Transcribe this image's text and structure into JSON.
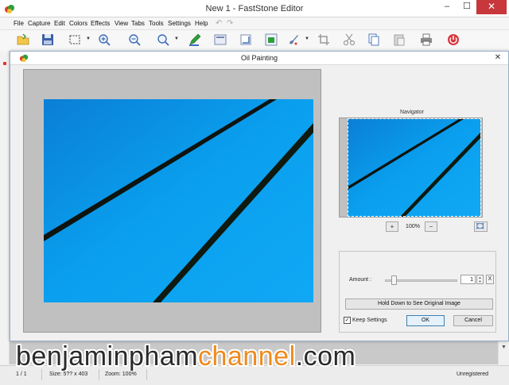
{
  "window": {
    "title": "New 1 - FastStone Editor",
    "controls": {
      "minimize": "–",
      "maximize": "☐",
      "close": "✕"
    }
  },
  "menu": [
    {
      "label": "File"
    },
    {
      "label": "Capture"
    },
    {
      "label": "Edit"
    },
    {
      "label": "Colors"
    },
    {
      "label": "Effects"
    },
    {
      "label": "View"
    },
    {
      "label": "Tabs"
    },
    {
      "label": "Tools"
    },
    {
      "label": "Settings"
    },
    {
      "label": "Help"
    }
  ],
  "toolbar": {
    "icons": [
      "open-folder-icon",
      "save-icon",
      "select-rectangle-icon",
      "zoom-in-icon",
      "zoom-out-icon",
      "zoom-100-icon",
      "draw-icon",
      "caption-icon",
      "edge-icon",
      "resize-icon",
      "paint-icon",
      "crop-icon",
      "cut-icon",
      "copy-icon",
      "paste-icon",
      "print-icon",
      "close-power-icon"
    ]
  },
  "dialog": {
    "title": "Oil Painting",
    "close": "✕",
    "navigator": {
      "label": "Navigator",
      "zoom_level": "100%",
      "zoom_in": "+",
      "zoom_out": "−"
    },
    "amount": {
      "label": "Amount :",
      "value": "1",
      "level": 0.1,
      "reset_label": "X"
    },
    "hold_button": "Hold Down to See Original Image",
    "keep_settings": {
      "label": "Keep Settings",
      "checked": true,
      "mark": "✓"
    },
    "ok": "OK",
    "cancel": "Cancel"
  },
  "status": {
    "page": "1 / 1",
    "size": "Size: 5?? x 403",
    "zoom": "Zoom: 100%",
    "registration": "Unregistered"
  },
  "watermark": {
    "part1": "benjaminpham",
    "part2": "channel",
    "part3": ".com"
  },
  "colors": {
    "wallpaper_blue": "#0a9aee",
    "stripe": "#0e1410",
    "close_red": "#c7373b",
    "watermark_orange": "#f08a1c"
  }
}
